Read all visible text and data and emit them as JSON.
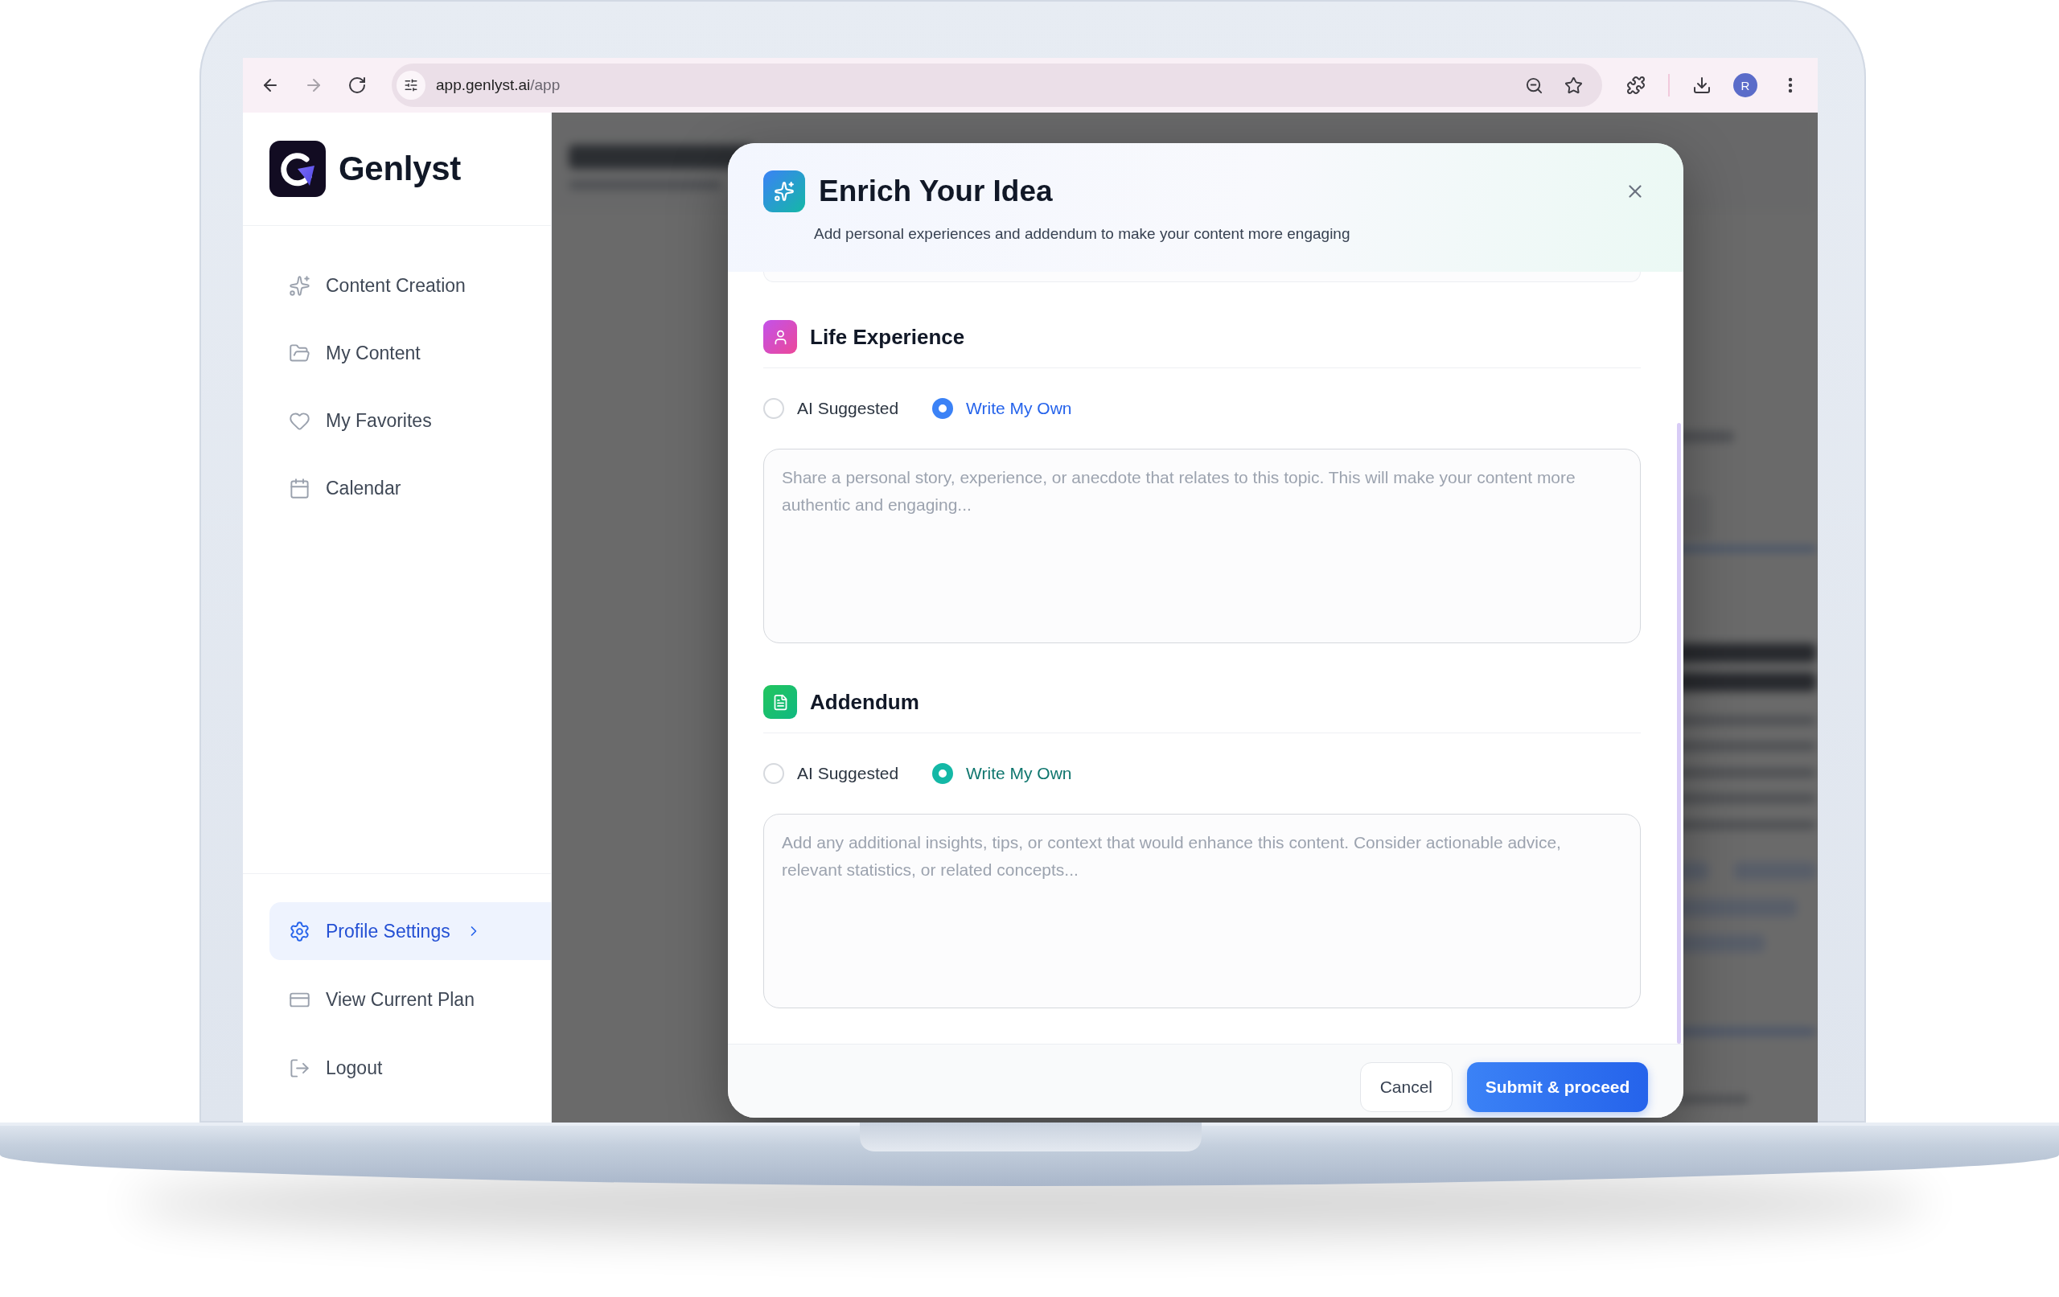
{
  "browser": {
    "nav_buttons": [
      {
        "kind": "back",
        "disabled": false
      },
      {
        "kind": "forward",
        "disabled": true
      },
      {
        "kind": "reload",
        "disabled": false
      }
    ],
    "url_host": "app.genlyst.ai",
    "url_path": "/app",
    "profile_initial": "R"
  },
  "sidebar": {
    "brand": "Genlyst",
    "nav_items": [
      {
        "label": "Content Creation",
        "selected": false
      },
      {
        "label": "My Content",
        "selected": false
      },
      {
        "label": "My Favorites",
        "selected": false
      },
      {
        "label": "Calendar",
        "selected": false
      }
    ],
    "account_items": [
      {
        "label": "Profile Settings",
        "selected": true
      },
      {
        "label": "View Current Plan",
        "selected": false
      },
      {
        "label": "Logout",
        "selected": false
      }
    ]
  },
  "modal": {
    "title": "Enrich Your Idea",
    "subtitle": "Add personal experiences and addendum to make your content more engaging",
    "sections": [
      {
        "kind": "experience",
        "title": "Life Experience",
        "options": [
          {
            "label": "AI Suggested",
            "selected": false
          },
          {
            "label": "Write My Own",
            "selected": true
          }
        ],
        "placeholder": "Share a personal story, experience, or anecdote that relates to this topic. This will make your content more authentic and engaging..."
      },
      {
        "kind": "addendum",
        "title": "Addendum",
        "options": [
          {
            "label": "AI Suggested",
            "selected": false
          },
          {
            "label": "Write My Own",
            "selected": true
          }
        ],
        "placeholder": "Add any additional insights, tips, or context that would enhance this content. Consider actionable advice, relevant statistics, or related concepts..."
      }
    ],
    "buttons": [
      {
        "kind": "secondary",
        "label": "Cancel"
      },
      {
        "kind": "primary",
        "label": "Submit & proceed"
      }
    ]
  }
}
